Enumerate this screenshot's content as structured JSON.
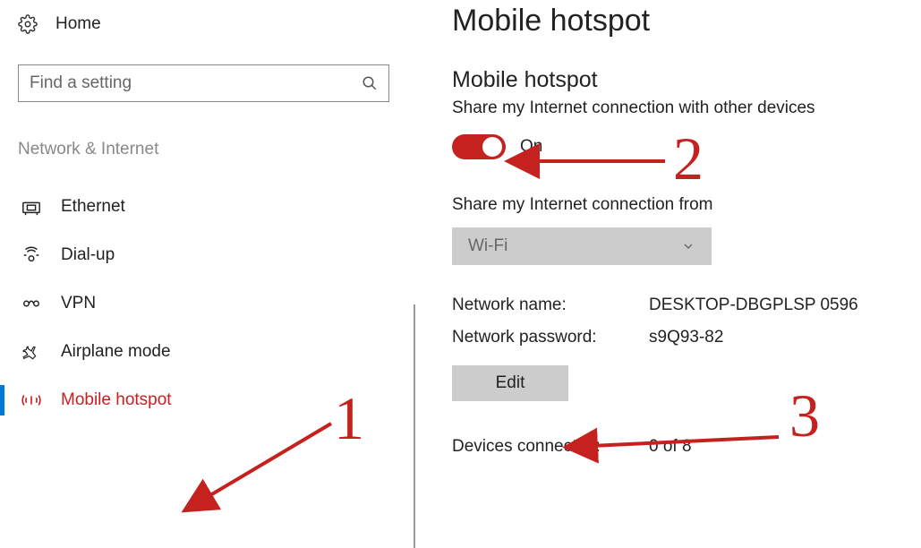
{
  "sidebar": {
    "home": "Home",
    "search_placeholder": "Find a setting",
    "section": "Network & Internet",
    "items": [
      {
        "label": "Ethernet",
        "icon": "ethernet-icon"
      },
      {
        "label": "Dial-up",
        "icon": "dialup-icon"
      },
      {
        "label": "VPN",
        "icon": "vpn-icon"
      },
      {
        "label": "Airplane mode",
        "icon": "airplane-icon"
      },
      {
        "label": "Mobile hotspot",
        "icon": "hotspot-icon",
        "active": true
      }
    ]
  },
  "main": {
    "title": "Mobile hotspot",
    "section_title": "Mobile hotspot",
    "share_desc": "Share my Internet connection with other devices",
    "toggle_state": "On",
    "share_from_label": "Share my Internet connection from",
    "share_from_value": "Wi-Fi",
    "network_name_label": "Network name:",
    "network_name_value": "DESKTOP-DBGPLSP 0596",
    "network_password_label": "Network password:",
    "network_password_value": "s9Q93-82",
    "edit_label": "Edit",
    "devices_label": "Devices connected:",
    "devices_value": "0 of 8"
  },
  "annotations": {
    "n1": "1",
    "n2": "2",
    "n3": "3"
  }
}
